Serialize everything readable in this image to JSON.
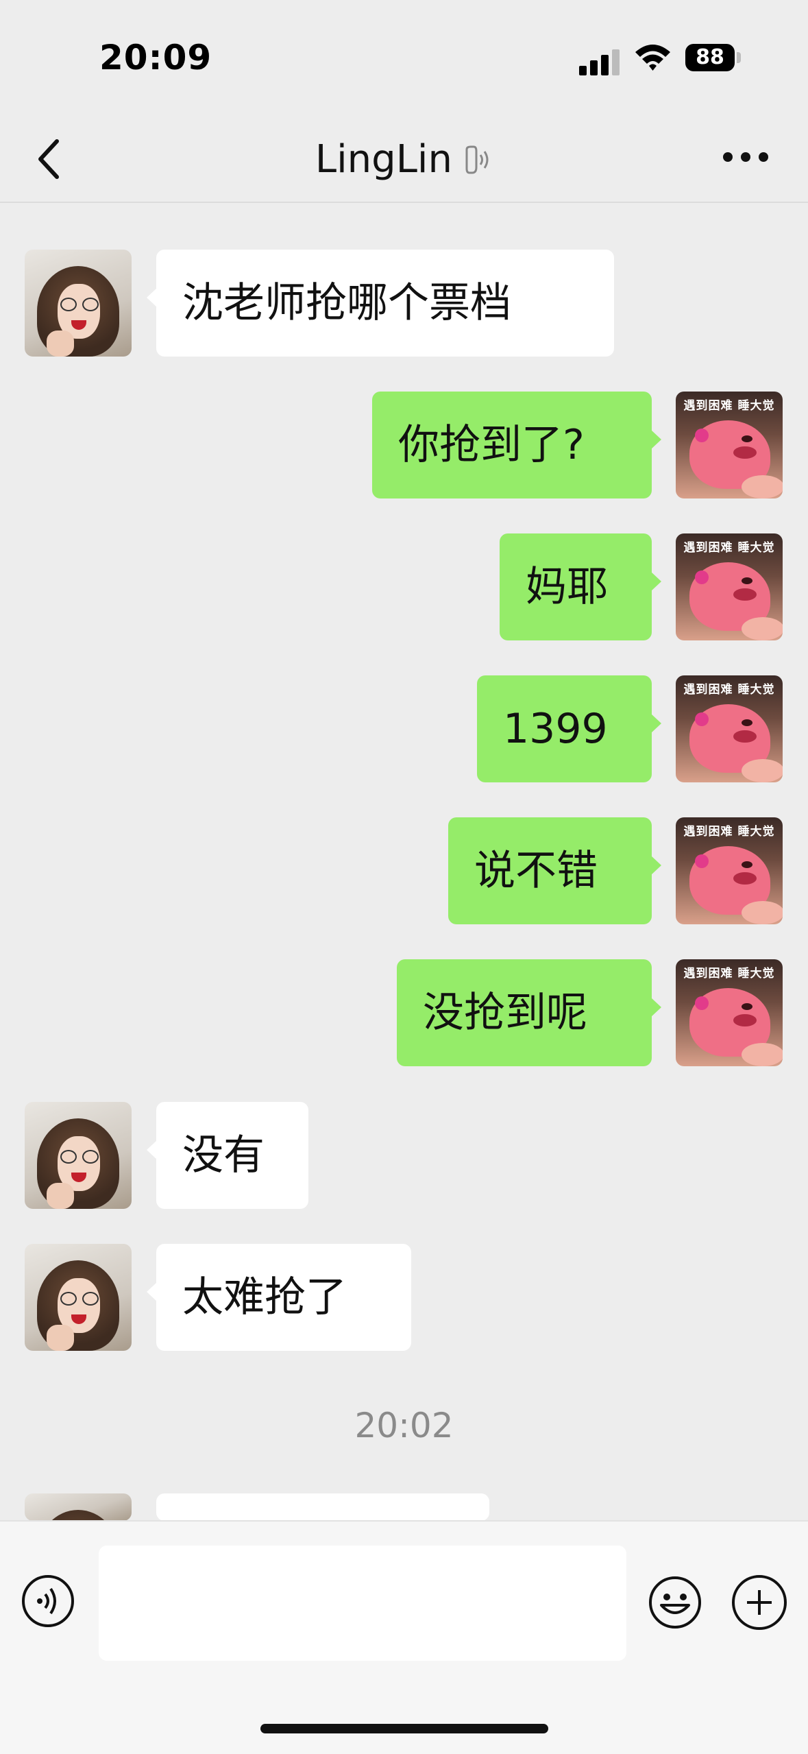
{
  "status_bar": {
    "time": "20:09",
    "battery": "88"
  },
  "header": {
    "title": "LingLin"
  },
  "contact_avatar_caption": "遇到困难 睡大觉",
  "messages": [
    {
      "side": "in",
      "text": "沈老师抢哪个票档"
    },
    {
      "side": "out",
      "text": "你抢到了?"
    },
    {
      "side": "out",
      "text": "妈耶"
    },
    {
      "side": "out",
      "text": "1399"
    },
    {
      "side": "out",
      "text": "说不错"
    },
    {
      "side": "out",
      "text": "没抢到呢"
    },
    {
      "side": "in",
      "text": "没有"
    },
    {
      "side": "in",
      "text": "太难抢了"
    },
    {
      "side": "in",
      "text": ""
    }
  ],
  "timestamp": "20:02",
  "input": {
    "value": ""
  }
}
